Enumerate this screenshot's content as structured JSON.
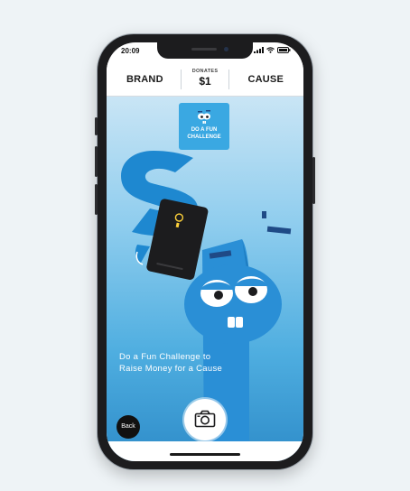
{
  "status_bar": {
    "time": "20:09"
  },
  "top_bar": {
    "brand_label": "BRAND",
    "donates_label": "DONATES",
    "donates_amount": "$1",
    "cause_label": "CAUSE"
  },
  "badge": {
    "line1": "DO A FUN",
    "line2": "CHALLENGE"
  },
  "caption": {
    "line1": "Do a Fun Challenge to",
    "line2": "Raise Money for a Cause"
  },
  "controls": {
    "back_label": "Back",
    "camera_icon": "camera-icon"
  },
  "colors": {
    "accent": "#3aa8e2",
    "character": "#2a8fd6",
    "bar": "#ffffff"
  }
}
